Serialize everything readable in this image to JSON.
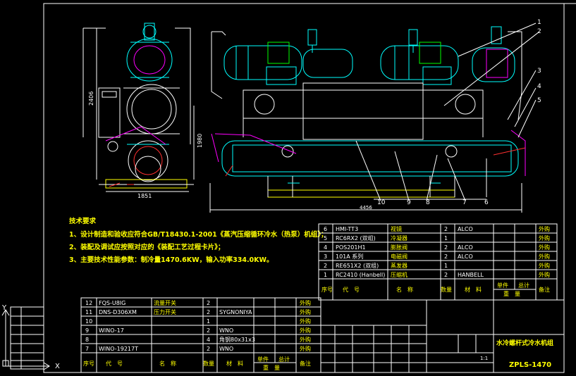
{
  "title_block": {
    "product_name": "水冷螺杆式冷水机组",
    "model": "ZPLS-1470",
    "scale": "1:1"
  },
  "tech_requirements": {
    "heading": "技术要求",
    "items": [
      "1、设计制造和验收应符合GB/T18430.1-2001《蒸汽压缩循环冷水（热泵）机组》；",
      "2、装配及调试应按照对应的《装配工艺过程卡片》；",
      "3、主要技术性能参数：制冷量1470.6KW，输入功率334.0KW。"
    ]
  },
  "dimensions": {
    "height_left": "2406",
    "height_mid": "1980",
    "width_left": "1851",
    "length_total": "4456"
  },
  "balloons": [
    "1",
    "2",
    "3",
    "4",
    "5",
    "6",
    "7",
    "8",
    "9",
    "10"
  ],
  "bom_upper": {
    "rows": [
      {
        "no": "6",
        "code": "HMI-TT3",
        "name": "视镜",
        "qty": "2",
        "material": "ALCO",
        "note": "外购"
      },
      {
        "no": "5",
        "code": "RC6RX2 (双组)",
        "name": "冷凝器",
        "qty": "1",
        "material": "",
        "note": "外购"
      },
      {
        "no": "4",
        "code": "POS201H1",
        "name": "膨胀阀",
        "qty": "2",
        "material": "ALCO",
        "note": "外购"
      },
      {
        "no": "3",
        "code": "101A 系列",
        "name": "电磁阀",
        "qty": "2",
        "material": "ALCO",
        "note": "外购"
      },
      {
        "no": "2",
        "code": "RE651X2 (双组)",
        "name": "蒸发器",
        "qty": "1",
        "material": "",
        "note": "外购"
      },
      {
        "no": "1",
        "code": "RC2410 (Hanbell)",
        "name": "压缩机",
        "qty": "2",
        "material": "HANBELL",
        "note": "外购"
      }
    ],
    "header": {
      "no": "序号",
      "code": "代　号",
      "name": "名　称",
      "qty": "数量",
      "material": "材　料",
      "unit": "单件",
      "total": "总计",
      "weight": "重　量",
      "note": "备注"
    }
  },
  "bom_lower": {
    "rows": [
      {
        "no": "12",
        "code": "FQS-U8IG",
        "name": "流量开关",
        "qty": "2",
        "material": "",
        "note": "外购"
      },
      {
        "no": "11",
        "code": "DNS-D306XM",
        "name": "压力开关",
        "qty": "2",
        "material": "SYGNONIYA",
        "note": "外购"
      },
      {
        "no": "10",
        "code": "",
        "name": "",
        "qty": "1",
        "material": "",
        "note": "外购"
      },
      {
        "no": "9",
        "code": "WINO-17",
        "name": "",
        "qty": "2",
        "material": "WNO",
        "note": "外购"
      },
      {
        "no": "8",
        "code": "",
        "name": "",
        "qty": "4",
        "material": "角钢80x31x3",
        "note": "外购"
      },
      {
        "no": "7",
        "code": "WINO-19217T",
        "name": "",
        "qty": "2",
        "material": "WNO",
        "note": "外购"
      }
    ],
    "header": {
      "no": "序号",
      "code": "代　号",
      "name": "名　称",
      "qty": "数量",
      "material": "材　料",
      "unit": "单件",
      "total": "总计",
      "weight": "重　量",
      "note": "备注"
    }
  },
  "axes": {
    "y": "Y",
    "x": "X"
  },
  "colors": {
    "background": "#000000",
    "frame": "#ffffff",
    "cyan": "#00ffff",
    "magenta": "#ff00ff",
    "yellow": "#ffff00",
    "red": "#ff3030",
    "green": "#00ff00"
  }
}
